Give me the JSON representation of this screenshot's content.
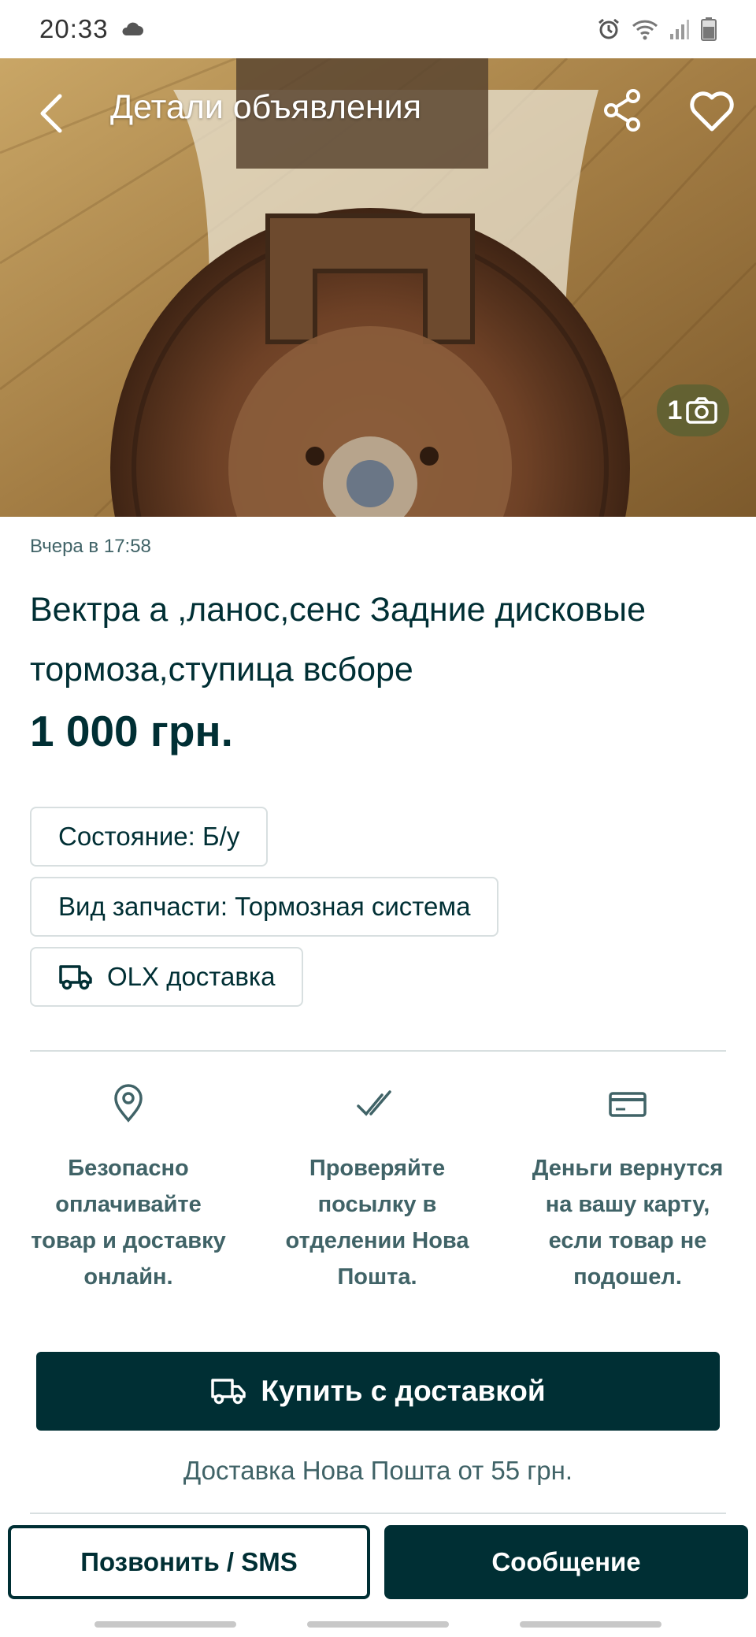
{
  "status_bar": {
    "time": "20:33",
    "icons": [
      "cloud-icon",
      "alarm-icon",
      "wifi-icon",
      "signal-icon",
      "battery-icon"
    ]
  },
  "app_bar": {
    "title": "Детали объявления",
    "icons": [
      "back-arrow-icon",
      "share-icon",
      "heart-icon"
    ]
  },
  "gallery": {
    "photo_count": "1",
    "icon": "camera-icon"
  },
  "listing": {
    "posted": "Вчера в 17:58",
    "title": "Вектра а ,ланос,сенс Задние дисковые тормоза,ступица всборе",
    "price": "1 000 грн."
  },
  "params": [
    "Состояние: Б/у",
    "Вид запчасти: Тормозная система",
    "OLX доставка"
  ],
  "features": [
    {
      "icon": "location-pin-icon",
      "text": "Безопасно оплачивайте товар и доставку онлайн."
    },
    {
      "icon": "double-check-icon",
      "text": "Проверяйте посылку в отделении Нова Пошта."
    },
    {
      "icon": "credit-card-icon",
      "text": "Деньги вернутся на вашу карту, если товар не подошел."
    }
  ],
  "actions": {
    "buy_label": "Купить с доставкой",
    "delivery_note": "Доставка Нова Пошта от 55 грн.",
    "call_label": "Позвонить / SMS",
    "message_label": "Сообщение"
  },
  "colors": {
    "primary": "#002f34",
    "muted_text": "#406367",
    "border": "#d8dfe0"
  }
}
